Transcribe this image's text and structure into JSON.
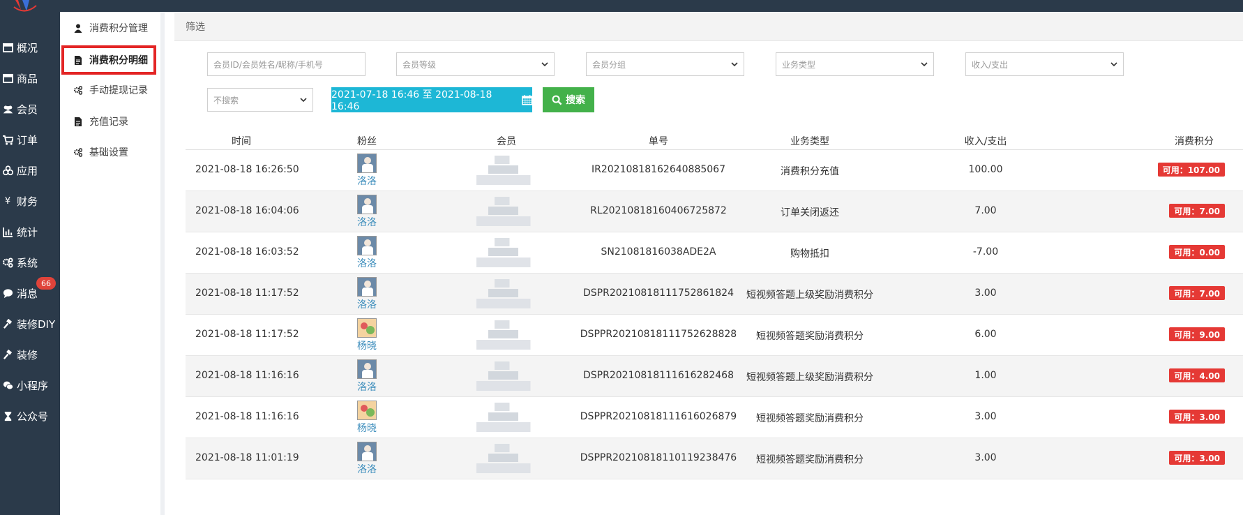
{
  "nav": {
    "items": [
      {
        "label": "概况",
        "icon": "dashboard-icon"
      },
      {
        "label": "商品",
        "icon": "goods-icon"
      },
      {
        "label": "会员",
        "icon": "users-icon"
      },
      {
        "label": "订单",
        "icon": "cart-icon"
      },
      {
        "label": "应用",
        "icon": "apps-icon"
      },
      {
        "label": "财务",
        "icon": "yen-icon"
      },
      {
        "label": "统计",
        "icon": "bar-chart-icon"
      },
      {
        "label": "系统",
        "icon": "gears-icon"
      },
      {
        "label": "消息",
        "icon": "comment-icon",
        "badge": "66"
      },
      {
        "label": "装修DIY",
        "icon": "gavel-icon"
      },
      {
        "label": "装修",
        "icon": "gavel-icon"
      },
      {
        "label": "小程序",
        "icon": "wechat-icon"
      },
      {
        "label": "公众号",
        "icon": "hourglass-icon"
      }
    ]
  },
  "subnav": {
    "items": [
      {
        "label": "消费积分管理",
        "icon": "user-icon"
      },
      {
        "label": "消费积分明细",
        "icon": "file-icon",
        "active": true
      },
      {
        "label": "手动提现记录",
        "icon": "gears-icon"
      },
      {
        "label": "充值记录",
        "icon": "file-icon"
      },
      {
        "label": "基础设置",
        "icon": "gears-icon"
      }
    ]
  },
  "filter": {
    "title": "筛选",
    "member_placeholder": "会员ID/会员姓名/昵称/手机号",
    "level_select": "会员等级",
    "group_select": "会员分组",
    "type_select": "业务类型",
    "io_select": "收入/支出",
    "search_select": "不搜索",
    "date_range": "2021-07-18 16:46 至 2021-08-18 16:46",
    "search_button": "搜索"
  },
  "table": {
    "headers": {
      "time": "时间",
      "fan": "粉丝",
      "member": "会员",
      "order_no": "单号",
      "biz_type": "业务类型",
      "io": "收入/支出",
      "points": "消费积分"
    },
    "rows": [
      {
        "time": "2021-08-18 16:26:50",
        "fan": "洛洛",
        "avatar": "person",
        "order_no": "IR20210818162640885067",
        "biz_type": "消费积分充值",
        "io": "100.00",
        "points": "可用：107.00"
      },
      {
        "time": "2021-08-18 16:04:06",
        "fan": "洛洛",
        "avatar": "person",
        "order_no": "RL20210818160406725872",
        "biz_type": "订单关闭返还",
        "io": "7.00",
        "points": "可用：7.00"
      },
      {
        "time": "2021-08-18 16:03:52",
        "fan": "洛洛",
        "avatar": "person",
        "order_no": "SN21081816038ADE2A",
        "biz_type": "购物抵扣",
        "io": "-7.00",
        "points": "可用：0.00"
      },
      {
        "time": "2021-08-18 11:17:52",
        "fan": "洛洛",
        "avatar": "person",
        "order_no": "DSPR20210818111752861824",
        "biz_type": "短视频答题上级奖励消费积分",
        "io": "3.00",
        "points": "可用：7.00"
      },
      {
        "time": "2021-08-18 11:17:52",
        "fan": "杨晓",
        "avatar": "flower",
        "order_no": "DSPPR20210818111752628828",
        "biz_type": "短视频答题奖励消费积分",
        "io": "6.00",
        "points": "可用：9.00"
      },
      {
        "time": "2021-08-18 11:16:16",
        "fan": "洛洛",
        "avatar": "person",
        "order_no": "DSPR20210818111616282468",
        "biz_type": "短视频答题上级奖励消费积分",
        "io": "1.00",
        "points": "可用：4.00"
      },
      {
        "time": "2021-08-18 11:16:16",
        "fan": "杨晓",
        "avatar": "flower",
        "order_no": "DSPPR20210818111616026879",
        "biz_type": "短视频答题奖励消费积分",
        "io": "3.00",
        "points": "可用：3.00"
      },
      {
        "time": "2021-08-18 11:01:19",
        "fan": "洛洛",
        "avatar": "person",
        "order_no": "DSPPR20210818110119238476",
        "biz_type": "短视频答题奖励消费积分",
        "io": "3.00",
        "points": "可用：3.00"
      }
    ]
  },
  "colors": {
    "sidebar": "#2b3a4a",
    "date_button": "#1db7d6",
    "search_button": "#43b14a",
    "points_badge": "#e53935",
    "active_outline": "#e32525",
    "link": "#3c8dbc"
  }
}
